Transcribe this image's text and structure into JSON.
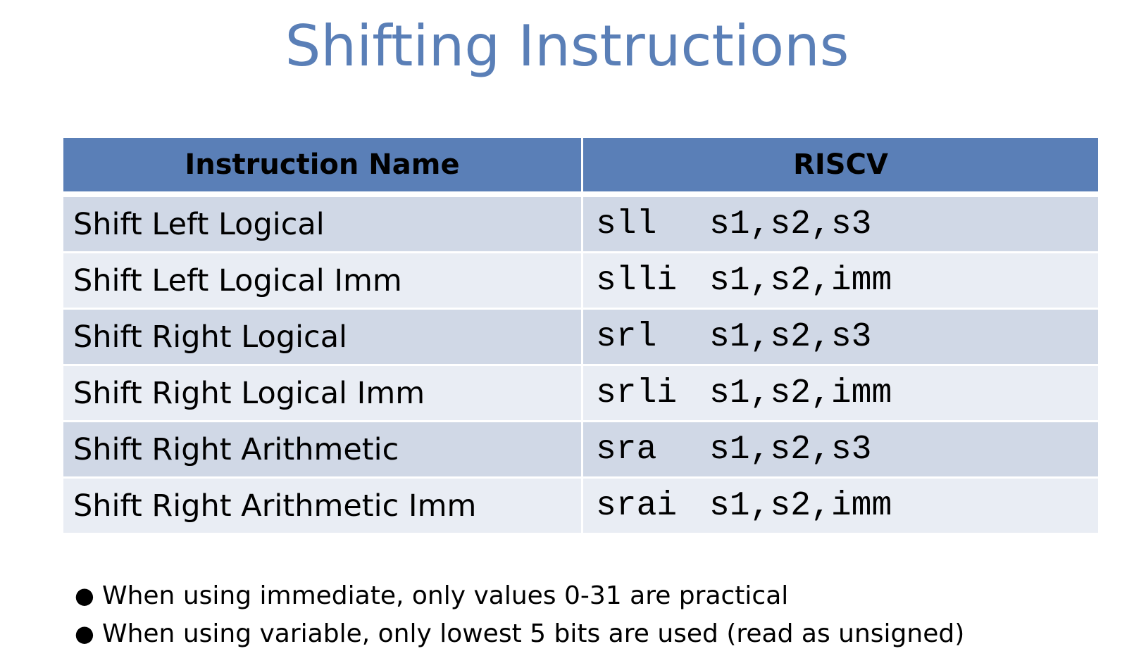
{
  "slide": {
    "title": "Shifting Instructions"
  },
  "table": {
    "headers": [
      "Instruction Name",
      "RISCV"
    ],
    "rows": [
      {
        "name": "Shift Left Logical",
        "op": "sll",
        "args": "s1,s2,s3"
      },
      {
        "name": "Shift Left Logical Imm",
        "op": "slli",
        "args": "s1,s2,imm"
      },
      {
        "name": "Shift Right Logical",
        "op": "srl",
        "args": "s1,s2,s3"
      },
      {
        "name": "Shift Right Logical Imm",
        "op": "srli",
        "args": "s1,s2,imm"
      },
      {
        "name": "Shift Right Arithmetic",
        "op": "sra",
        "args": "s1,s2,s3"
      },
      {
        "name": "Shift Right Arithmetic Imm",
        "op": "srai",
        "args": "s1,s2,imm"
      }
    ]
  },
  "notes": [
    "When using immediate, only values 0-31 are practical",
    "When using variable, only lowest 5 bits are used (read as unsigned)"
  ],
  "colors": {
    "title": "#5a7fb7",
    "header_bg": "#5a7fb7",
    "row_dark": "#d0d8e6",
    "row_light": "#e9edf4"
  }
}
